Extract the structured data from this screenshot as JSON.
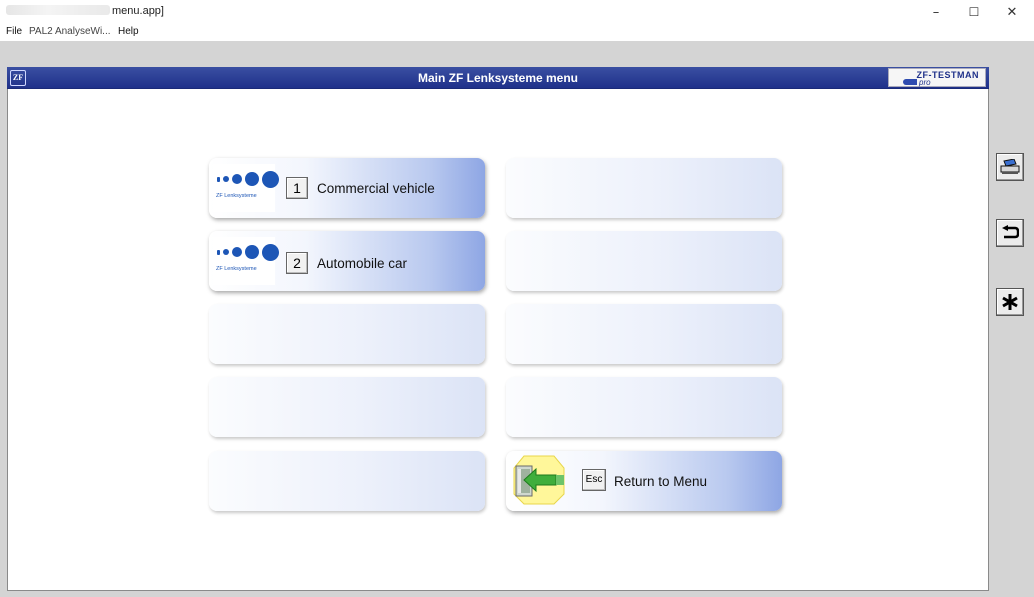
{
  "window": {
    "title": "menu.app]",
    "minimize_glyph": "–",
    "maximize_glyph": "☐",
    "close_glyph": "✕"
  },
  "menubar": {
    "items": [
      "File",
      "PAL2 AnalyseWi...",
      "Help"
    ]
  },
  "header": {
    "logo_text": "ZF",
    "title": "Main ZF Lenksysteme menu",
    "brand_top": "ZF-TESTMAN",
    "brand_bottom": "pro"
  },
  "tiles": [
    {
      "logo_text": "ZF Lenksysteme",
      "key": "1",
      "label": "Commercial vehicle"
    },
    {
      "logo_text": "ZF Lenksysteme",
      "key": "2",
      "label": "Automobile car"
    }
  ],
  "exit_tile": {
    "key": "Esc",
    "label": "Return to Menu"
  },
  "side_toolbar": {
    "icons": [
      "printer-icon",
      "return-arrow-icon",
      "asterisk-icon"
    ]
  },
  "colors": {
    "header_blue": "#23358f",
    "logo_blue": "#1d56b6",
    "active_tile_gradient_end": "#8ea6e4"
  }
}
